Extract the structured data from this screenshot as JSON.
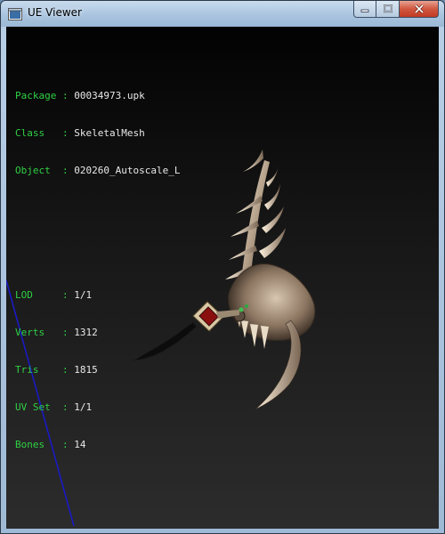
{
  "window": {
    "title": "UE Viewer"
  },
  "info": {
    "sections": [
      [
        {
          "key": "Package",
          "sep": " : ",
          "value": "00034973.upk"
        },
        {
          "key": "Class  ",
          "sep": " : ",
          "value": "SkeletalMesh"
        },
        {
          "key": "Object ",
          "sep": " : ",
          "value": "020260_Autoscale_L"
        }
      ],
      [
        {
          "key": "LOD    ",
          "sep": " : ",
          "value": "1/1"
        },
        {
          "key": "Verts  ",
          "sep": " : ",
          "value": "1312"
        },
        {
          "key": "Tris   ",
          "sep": " : ",
          "value": "1815"
        },
        {
          "key": "UV Set ",
          "sep": " : ",
          "value": "1/1"
        },
        {
          "key": "Bones  ",
          "sep": " : ",
          "value": "14"
        }
      ]
    ]
  },
  "colors": {
    "label": "#2fd045",
    "value": "#e8e8e8",
    "axis_line": "#1a1acc"
  }
}
